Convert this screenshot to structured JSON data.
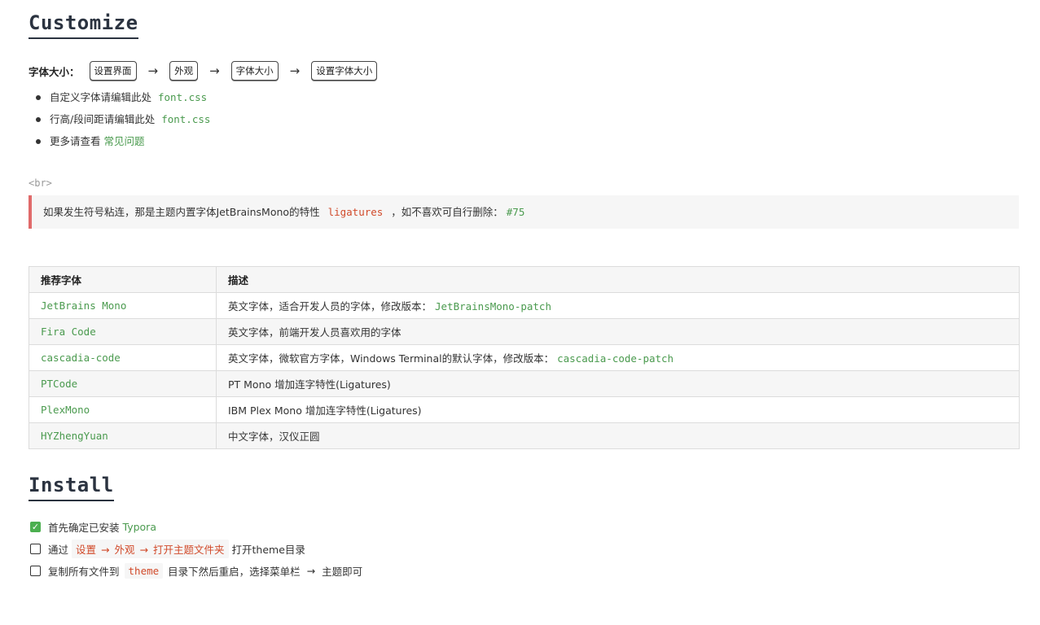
{
  "customize": {
    "heading": "Customize",
    "font_size_label": "字体大小：",
    "path_keys": [
      "设置界面",
      "外观",
      "字体大小",
      "设置字体大小"
    ],
    "arrow": "→",
    "bullets": [
      {
        "text": "自定义字体请编辑此处",
        "code": "font.css"
      },
      {
        "text": "行高/段间距请编辑此处",
        "code": "font.css"
      },
      {
        "text": "更多请查看",
        "link": "常见问题"
      }
    ],
    "br_tag": "<br>",
    "quote": {
      "before": "如果发生符号粘连，那是主题内置字体JetBrainsMono的特性",
      "code": "ligatures",
      "after": "，如不喜欢可自行删除：",
      "issue": "#75"
    }
  },
  "table": {
    "headers": [
      "推荐字体",
      "描述"
    ],
    "rows": [
      {
        "font": "JetBrains Mono",
        "desc": "英文字体，适合开发人员的字体，修改版本：",
        "extra": "JetBrainsMono-patch"
      },
      {
        "font": "Fira Code",
        "desc": "英文字体，前端开发人员喜欢用的字体",
        "extra": ""
      },
      {
        "font": "cascadia-code",
        "desc": "英文字体，微软官方字体，Windows Terminal的默认字体，修改版本：",
        "extra": "cascadia-code-patch"
      },
      {
        "font": "PTCode",
        "desc": "PT Mono 增加连字特性(Ligatures)",
        "extra": ""
      },
      {
        "font": "PlexMono",
        "desc": "IBM Plex Mono 增加连字特性(Ligatures)",
        "extra": ""
      },
      {
        "font": "HYZhengYuan",
        "desc": "中文字体，汉仪正圆",
        "extra": ""
      }
    ]
  },
  "install": {
    "heading": "Install",
    "task1": {
      "checked": true,
      "text": "首先确定已安装",
      "link": "Typora"
    },
    "task2": {
      "checked": false,
      "before": "通过",
      "steps": [
        "设置",
        "外观",
        "打开主题文件夹"
      ],
      "arrow": "→",
      "after": "打开theme目录"
    },
    "task3": {
      "checked": false,
      "before": "复制所有文件到",
      "code": "theme",
      "after": "目录下然后重启，选择菜单栏",
      "arrow": "→",
      "end": "主题即可"
    }
  },
  "colors": {
    "accent_green": "#4a9a4e",
    "code_red": "#d14a2a",
    "quote_border": "#e06a6a",
    "check_green": "#4caf50"
  }
}
